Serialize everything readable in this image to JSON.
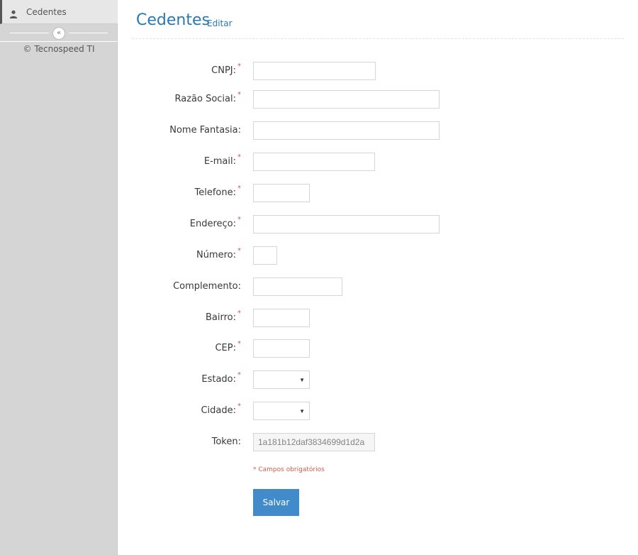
{
  "sidebar": {
    "items": [
      {
        "label": "Cedentes",
        "icon": "user-icon"
      }
    ],
    "collapse_glyph": "«",
    "copyright": "© Tecnospeed TI"
  },
  "header": {
    "title": "Cedentes",
    "subtitle": "Editar"
  },
  "form": {
    "required_marker": "*",
    "cnpj_label": "CNPJ:",
    "razao_social_label": "Razão Social:",
    "nome_fantasia_label": "Nome Fantasia:",
    "email_label": "E-mail:",
    "telefone_label": "Telefone:",
    "endereco_label": "Endereço:",
    "numero_label": "Número:",
    "complemento_label": "Complemento:",
    "bairro_label": "Bairro:",
    "cep_label": "CEP:",
    "estado_label": "Estado:",
    "cidade_label": "Cidade:",
    "token_label": "Token:",
    "token_value": "1a181b12daf3834699d1d2a",
    "required_note": "* Campos obrigatórios",
    "save_label": "Salvar"
  },
  "colors": {
    "accent": "#2679b5",
    "button": "#428bca",
    "required": "#d15b47",
    "sidebar": "#d5d5d5"
  }
}
